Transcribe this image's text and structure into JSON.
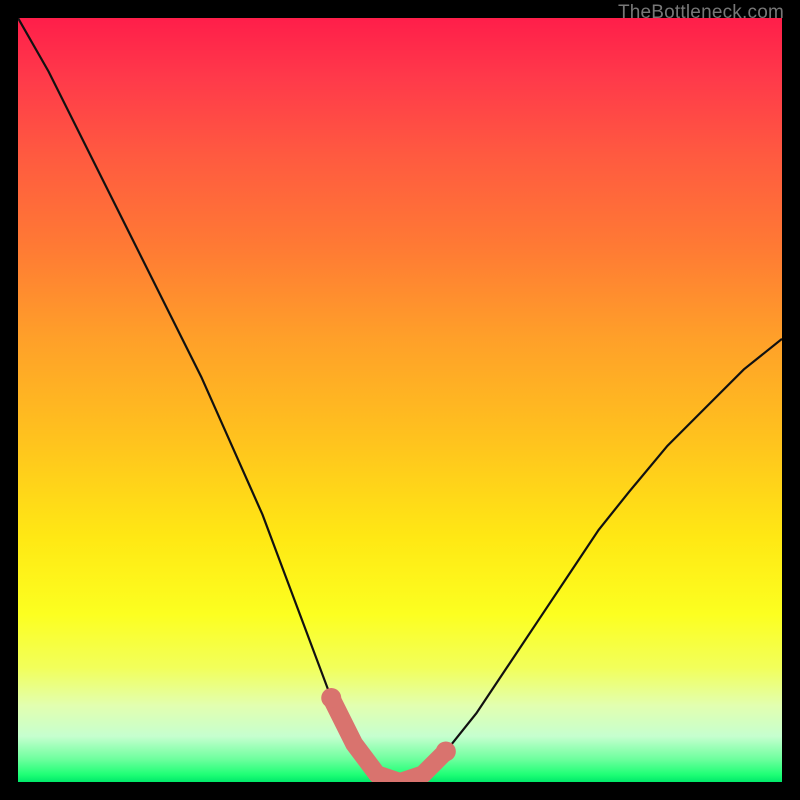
{
  "watermark": {
    "text": "TheBottleneck.com"
  },
  "colors": {
    "curve": "#111111",
    "band": "#d9736e",
    "frame": "#000000"
  },
  "chart_data": {
    "type": "line",
    "title": "",
    "xlabel": "",
    "ylabel": "",
    "xlim": [
      0,
      100
    ],
    "ylim": [
      0,
      100
    ],
    "grid": false,
    "legend": false,
    "series": [
      {
        "name": "bottleneck-curve",
        "x": [
          0,
          4,
          8,
          12,
          16,
          20,
          24,
          28,
          32,
          35,
          38,
          41,
          44,
          47,
          50,
          53,
          56,
          60,
          64,
          68,
          72,
          76,
          80,
          85,
          90,
          95,
          100
        ],
        "y": [
          100,
          93,
          85,
          77,
          69,
          61,
          53,
          44,
          35,
          27,
          19,
          11,
          5,
          1,
          0,
          1,
          4,
          9,
          15,
          21,
          27,
          33,
          38,
          44,
          49,
          54,
          58
        ]
      }
    ],
    "highlight_band": {
      "name": "salmon-band",
      "x": [
        41,
        44,
        47,
        50,
        53,
        56
      ],
      "y": [
        11,
        5,
        1,
        0,
        1,
        4
      ]
    }
  }
}
